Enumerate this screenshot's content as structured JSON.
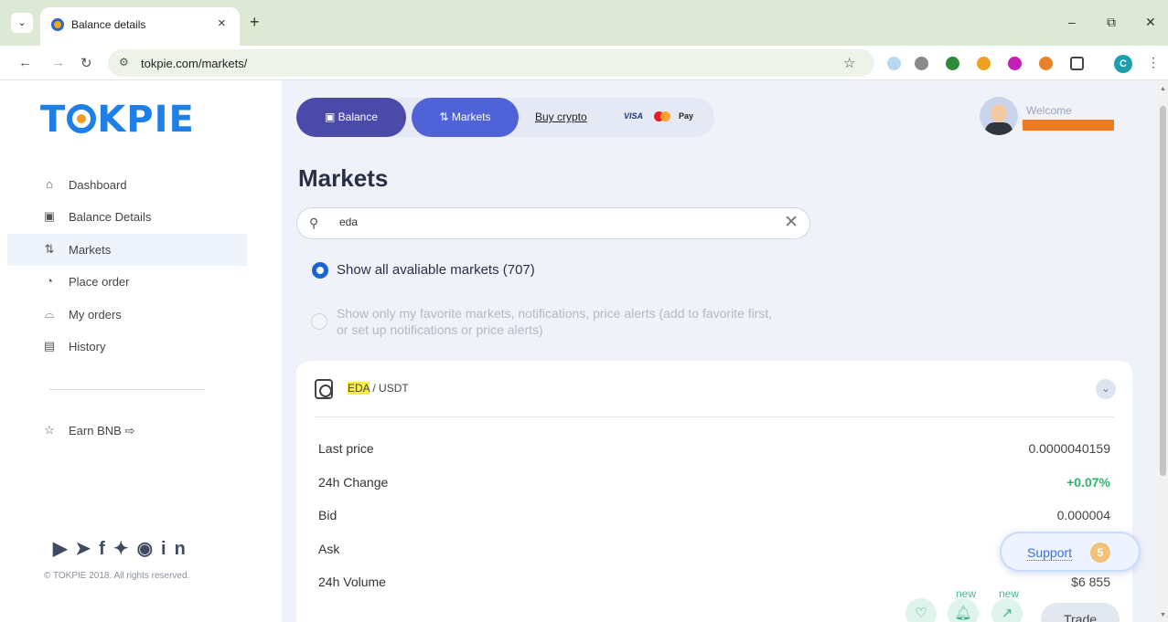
{
  "browser": {
    "tab_title": "Balance details",
    "tab_close": "×",
    "new_tab": "+",
    "tab_menu": "⌄",
    "url": "tokpie.com/markets/",
    "profile_initial": "C",
    "window": {
      "minimize": "–",
      "restore": "⧉",
      "close": "✕"
    }
  },
  "sidebar": {
    "logo": {
      "pre": "T",
      "post": "KPIE"
    },
    "items": [
      {
        "label": "Dashboard",
        "icon": "home-icon"
      },
      {
        "label": "Balance Details",
        "icon": "balance-icon"
      },
      {
        "label": "Markets",
        "icon": "markets-icon"
      },
      {
        "label": "Place order",
        "icon": "place-order-icon"
      },
      {
        "label": "My orders",
        "icon": "my-orders-icon"
      },
      {
        "label": "History",
        "icon": "history-icon"
      }
    ],
    "earn": {
      "label": "Earn BNB",
      "arrow": "⇨"
    },
    "copyright": "© TOKPIE 2018. All rights reserved."
  },
  "topnav": {
    "balance": "Balance",
    "markets": "Markets",
    "buy_crypto": "Buy crypto",
    "visa": "VISA",
    "apple_pay": "Pay"
  },
  "user": {
    "welcome": "Welcome"
  },
  "main": {
    "title": "Markets",
    "search": {
      "value": "eda"
    },
    "radio_all": "Show all avaliable markets (707)",
    "radio_fav": "Show only my favorite markets, notifications, price alerts (add to favorite first, or set up notifications or price alerts)"
  },
  "market": {
    "base": "EDA",
    "quote": "/ USDT",
    "rows": [
      {
        "label": "Last price",
        "value": "0.0000040159"
      },
      {
        "label": "24h Change",
        "value": "+0.07%"
      },
      {
        "label": "Bid",
        "value": "0.000004"
      },
      {
        "label": "Ask",
        "value": ""
      },
      {
        "label": "24h Volume",
        "value": "$6 855"
      }
    ],
    "new_label_1": "new",
    "new_label_2": "new",
    "trade": "Trade"
  },
  "support": {
    "label": "Support",
    "count": "5"
  },
  "colors": {
    "accent": "#4f63d6",
    "brand": "#1e7fe6",
    "positive": "#2eb56a",
    "highlight": "#f6ef3a"
  }
}
